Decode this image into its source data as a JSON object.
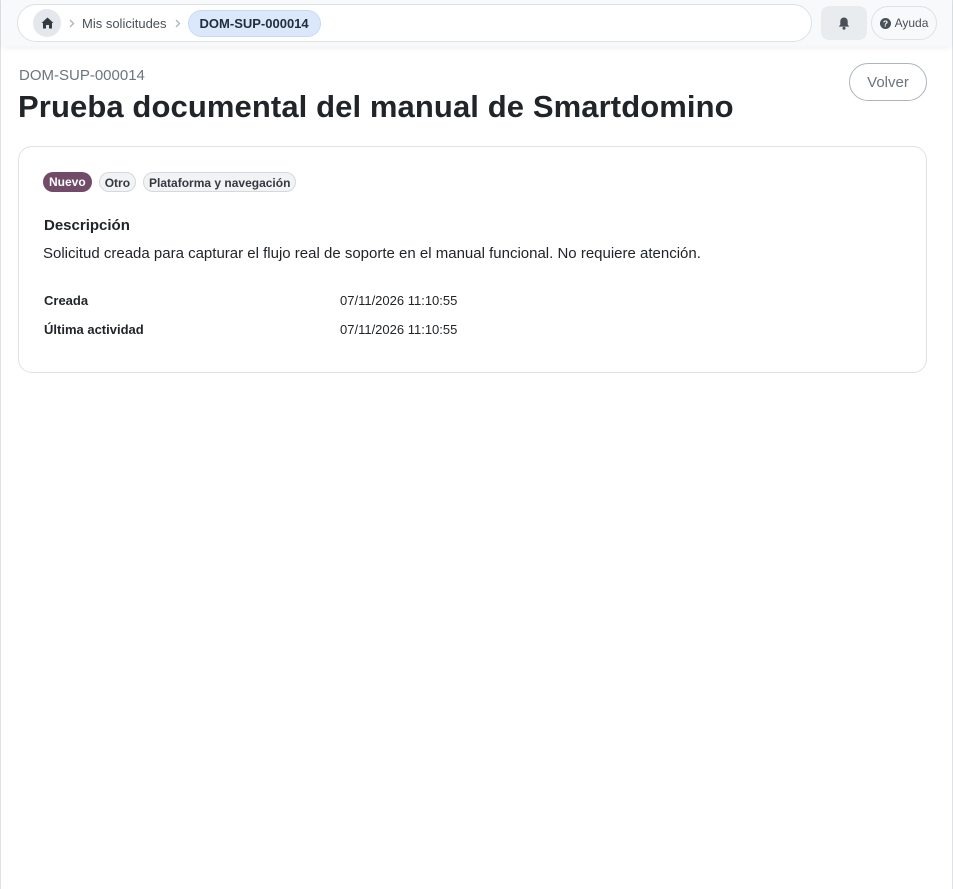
{
  "topbar": {
    "home_icon": "home-icon",
    "breadcrumb": {
      "parent_label": "Mis solicitudes",
      "current_label": "DOM-SUP-000014"
    },
    "notifications_icon": "bell-icon",
    "help_label": "Ayuda",
    "help_icon": "question-circle-icon"
  },
  "header": {
    "reference": "DOM-SUP-000014",
    "title": "Prueba documental del manual de Smartdomino",
    "back_label": "Volver"
  },
  "ticket": {
    "status": "Nuevo",
    "tags": [
      "Otro",
      "Plataforma y navegación"
    ],
    "description_label": "Descripción",
    "description": "Solicitud creada para capturar el flujo real de soporte en el manual funcional. No requiere atención.",
    "meta": [
      {
        "label": "Creada",
        "value": "07/11/2026 11:10:55"
      },
      {
        "label": "Última actividad",
        "value": "07/11/2026 11:10:55"
      }
    ]
  },
  "colors": {
    "status_badge": "#714b67",
    "breadcrumb_active": "#dbe8fb"
  }
}
